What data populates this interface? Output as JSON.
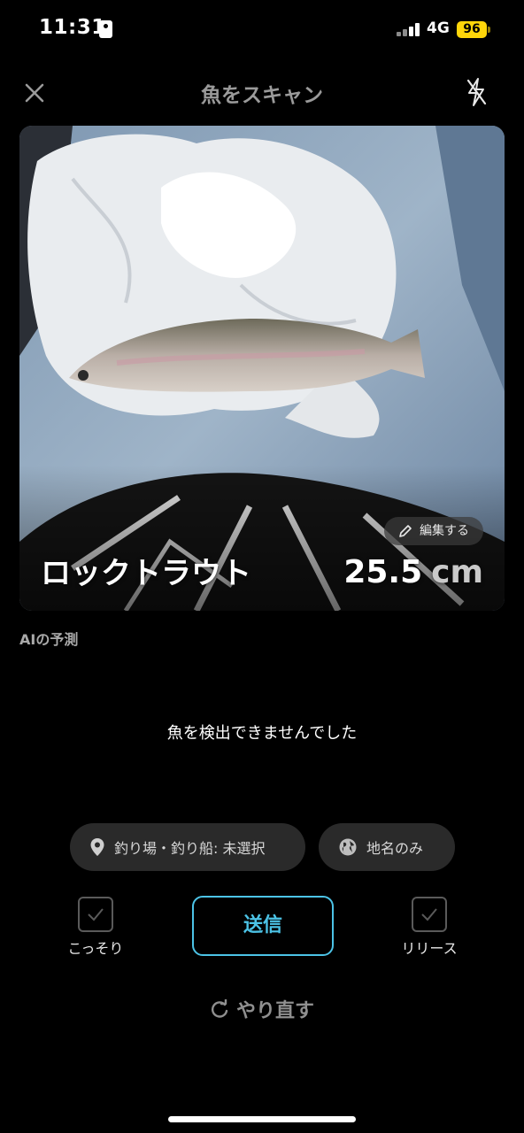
{
  "status_bar": {
    "time": "11:31",
    "network": "4G",
    "battery": "96"
  },
  "header": {
    "title": "魚をスキャン",
    "close_icon": "close-icon",
    "flash_icon": "flash-off-icon"
  },
  "photo": {
    "edit_label": "編集する",
    "species": "ロックトラウト",
    "length_value": "25.5",
    "length_unit": "cm"
  },
  "ai": {
    "label": "AIの予測",
    "message": "魚を検出できませんでした"
  },
  "chips": {
    "spot": "釣り場・釣り船: 未選択",
    "place": "地名のみ"
  },
  "options": {
    "secret": "こっそり",
    "release": "リリース",
    "secret_checked": false,
    "release_checked": false
  },
  "actions": {
    "send": "送信",
    "redo": "やり直す"
  },
  "colors": {
    "accent": "#4cc3e6",
    "battery": "#ffd60a",
    "chip_bg": "#2a2a2a"
  }
}
